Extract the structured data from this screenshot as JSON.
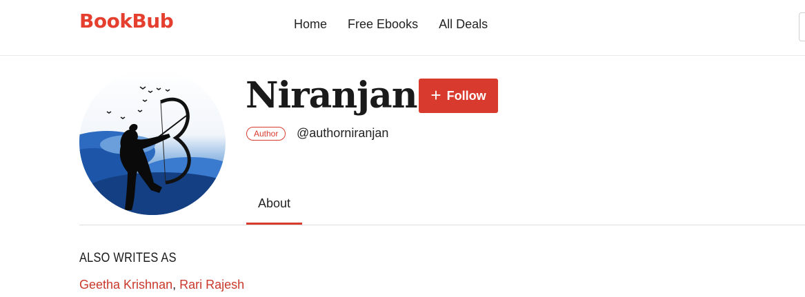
{
  "header": {
    "logo": "BookBub",
    "nav": [
      "Home",
      "Free Ebooks",
      "All Deals"
    ]
  },
  "profile": {
    "name": "Niranjan",
    "follow_label": "Follow",
    "role_badge": "Author",
    "handle": "@authorniranjan",
    "avatar_icon": "archer-silhouette-avatar"
  },
  "tabs": [
    {
      "label": "About",
      "active": true
    }
  ],
  "also_writes_as": {
    "heading": "ALSO WRITES AS",
    "names": [
      "Geetha Krishnan",
      "Rari Rajesh"
    ],
    "separator": ","
  },
  "colors": {
    "brand": "#e43f2f",
    "button": "#d93a2e",
    "link": "#c9382b"
  }
}
